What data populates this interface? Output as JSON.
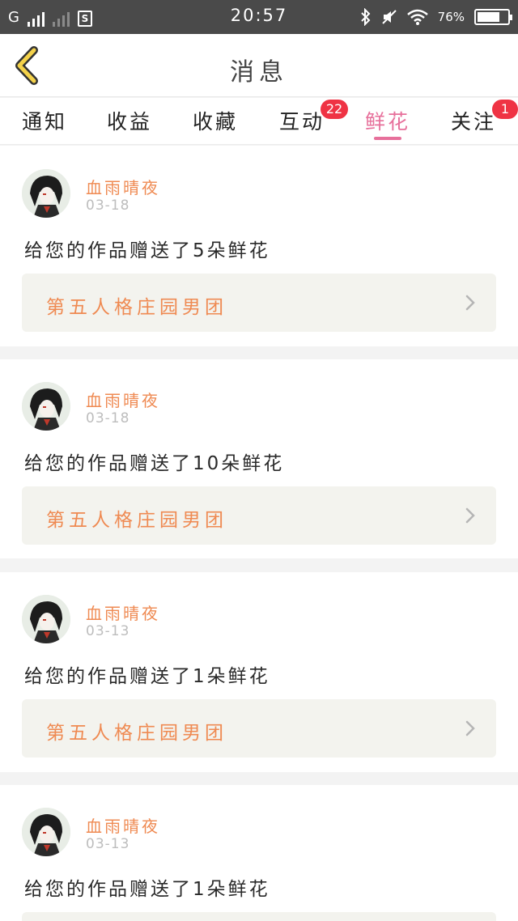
{
  "status_bar": {
    "network": "G",
    "time": "20:57",
    "battery": "76%",
    "battery_level": 0.76
  },
  "header": {
    "title": "消息"
  },
  "tabs": [
    {
      "label": "通知",
      "badge": ""
    },
    {
      "label": "收益",
      "badge": ""
    },
    {
      "label": "收藏",
      "badge": ""
    },
    {
      "label": "互动",
      "badge": "22"
    },
    {
      "label": "鲜花",
      "badge": "",
      "active": true
    },
    {
      "label": "关注",
      "badge": "1"
    }
  ],
  "messages": [
    {
      "user": "血雨晴夜",
      "date": "03-18",
      "text": "给您的作品赠送了5朵鲜花",
      "work": "第五人格庄园男团"
    },
    {
      "user": "血雨晴夜",
      "date": "03-18",
      "text": "给您的作品赠送了10朵鲜花",
      "work": "第五人格庄园男团"
    },
    {
      "user": "血雨晴夜",
      "date": "03-13",
      "text": "给您的作品赠送了1朵鲜花",
      "work": "第五人格庄园男团"
    },
    {
      "user": "血雨晴夜",
      "date": "03-13",
      "text": "给您的作品赠送了1朵鲜花",
      "work": ""
    }
  ]
}
